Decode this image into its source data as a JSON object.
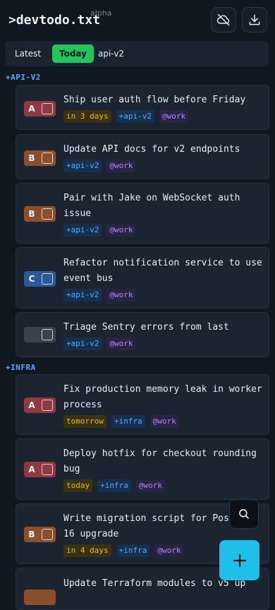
{
  "app": {
    "title": ">devtodo.txt",
    "badge": "alpha"
  },
  "header": {
    "icons": [
      "cloud-off-icon",
      "download-icon"
    ]
  },
  "tabs": [
    {
      "label": "Latest",
      "active": false
    },
    {
      "label": "Today",
      "active": true
    },
    {
      "label": "api-v2",
      "active": false
    }
  ],
  "groups": [
    {
      "label": "+API-V2",
      "tasks": [
        {
          "priority": "A",
          "title": "Ship user auth flow before Friday",
          "due": "in 3 days",
          "project": "+api-v2",
          "context": "@work"
        },
        {
          "priority": "B",
          "title": "Update API docs for v2 endpoints",
          "due": "",
          "project": "+api-v2",
          "context": "@work"
        },
        {
          "priority": "B",
          "title": "Pair with Jake on WebSocket auth issue",
          "due": "",
          "project": "+api-v2",
          "context": "@work"
        },
        {
          "priority": "C",
          "title": "Refactor notification service to use event bus",
          "due": "",
          "project": "+api-v2",
          "context": "@work"
        },
        {
          "priority": "",
          "title": "Triage Sentry errors from last deploy",
          "due": "",
          "project": "+api-v2",
          "context": "@work"
        }
      ]
    },
    {
      "label": "+INFRA",
      "tasks": [
        {
          "priority": "A",
          "title": "Fix production memory leak in worker process",
          "due": "tomorrow",
          "project": "+infra",
          "context": "@work"
        },
        {
          "priority": "A",
          "title": "Deploy hotfix for checkout rounding bug",
          "due": "today",
          "project": "+infra",
          "context": "@work"
        },
        {
          "priority": "B",
          "title": "Write migration script for Postgres 16 upgrade",
          "due": "in 4 days",
          "project": "+infra",
          "context": "@work"
        },
        {
          "priority": "",
          "title": "Update Terraform modules to v5 up",
          "due": "",
          "project": "",
          "context": ""
        }
      ]
    }
  ],
  "colors": {
    "priority_A": "#8e3a44",
    "priority_B": "#8a4f2c",
    "priority_C": "#2c5a94",
    "priority_none": "#3a424e",
    "accent_today": "#22c55e",
    "fab": "#1ec0e8"
  },
  "fab": {
    "search_icon": "search-icon",
    "add_icon": "plus-icon"
  }
}
